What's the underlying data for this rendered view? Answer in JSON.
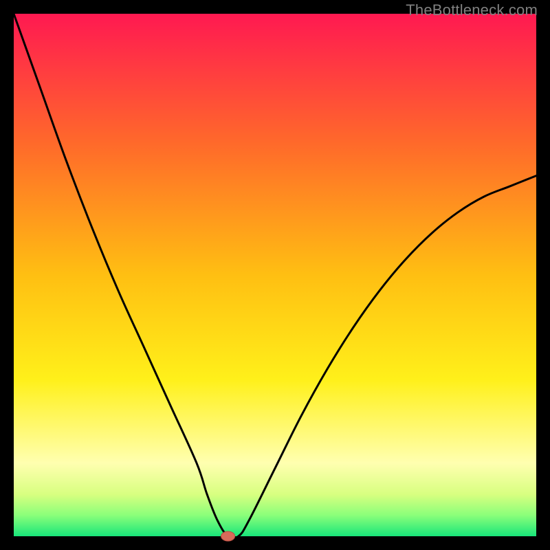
{
  "watermark": "TheBottleneck.com",
  "chart_data": {
    "type": "line",
    "title": "",
    "xlabel": "",
    "ylabel": "",
    "xlim": [
      0,
      100
    ],
    "ylim": [
      0,
      100
    ],
    "x": [
      0,
      5,
      10,
      15,
      20,
      25,
      30,
      35,
      37,
      39,
      41,
      43,
      45,
      50,
      55,
      60,
      65,
      70,
      75,
      80,
      85,
      90,
      95,
      100
    ],
    "values": [
      100,
      86,
      72,
      59,
      47,
      36,
      25,
      14,
      8,
      3,
      0,
      0,
      3,
      13,
      23,
      32,
      40,
      47,
      53,
      58,
      62,
      65,
      67,
      69
    ],
    "curve_min_x": 41,
    "marker": {
      "x": 41,
      "y": 0
    },
    "gradient_stops": [
      {
        "offset": 0.0,
        "color": "#ff1951"
      },
      {
        "offset": 0.25,
        "color": "#ff6a2a"
      },
      {
        "offset": 0.5,
        "color": "#ffbf12"
      },
      {
        "offset": 0.7,
        "color": "#fff01a"
      },
      {
        "offset": 0.86,
        "color": "#ffffb0"
      },
      {
        "offset": 0.92,
        "color": "#d8ff80"
      },
      {
        "offset": 0.96,
        "color": "#8aff7a"
      },
      {
        "offset": 1.0,
        "color": "#18e57a"
      }
    ],
    "border_width_px": 20
  }
}
